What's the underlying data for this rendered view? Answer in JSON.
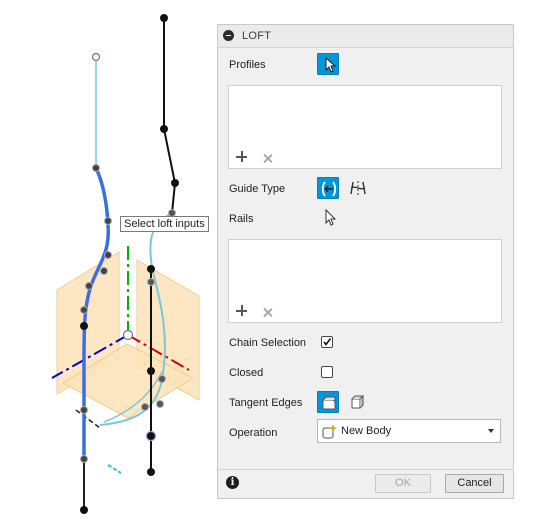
{
  "tooltip": {
    "text": "Select loft inputs"
  },
  "panel": {
    "title": "LOFT",
    "profiles_label": "Profiles",
    "guide_type_label": "Guide Type",
    "rails_label": "Rails",
    "chain_selection": {
      "label": "Chain Selection",
      "checked": true
    },
    "closed": {
      "label": "Closed",
      "checked": false
    },
    "tangent_edges_label": "Tangent Edges",
    "operation": {
      "label": "Operation",
      "value": "New Body"
    },
    "ok_label": "OK",
    "cancel_label": "Cancel"
  },
  "colors": {
    "accent": "#0696d7",
    "rail_selected": "#3b6fe0",
    "sketch_curve": "#7cc6d8",
    "plane_fill": "#fde3b8",
    "axis_x": "#d40000",
    "axis_y": "#00b400",
    "axis_z": "#0000c8"
  },
  "icons": {
    "collapse": "minus-circle-icon",
    "select": "cursor-arrow-icon",
    "rails_guide": "rails-guide-icon",
    "centerline_guide": "centerline-guide-icon",
    "add": "plus-icon",
    "remove": "x-icon",
    "tangent_edges_on": "tangent-edges-icon",
    "tangent_edges_off": "no-tangent-edges-icon",
    "new_body": "new-body-icon",
    "info": "info-icon"
  }
}
